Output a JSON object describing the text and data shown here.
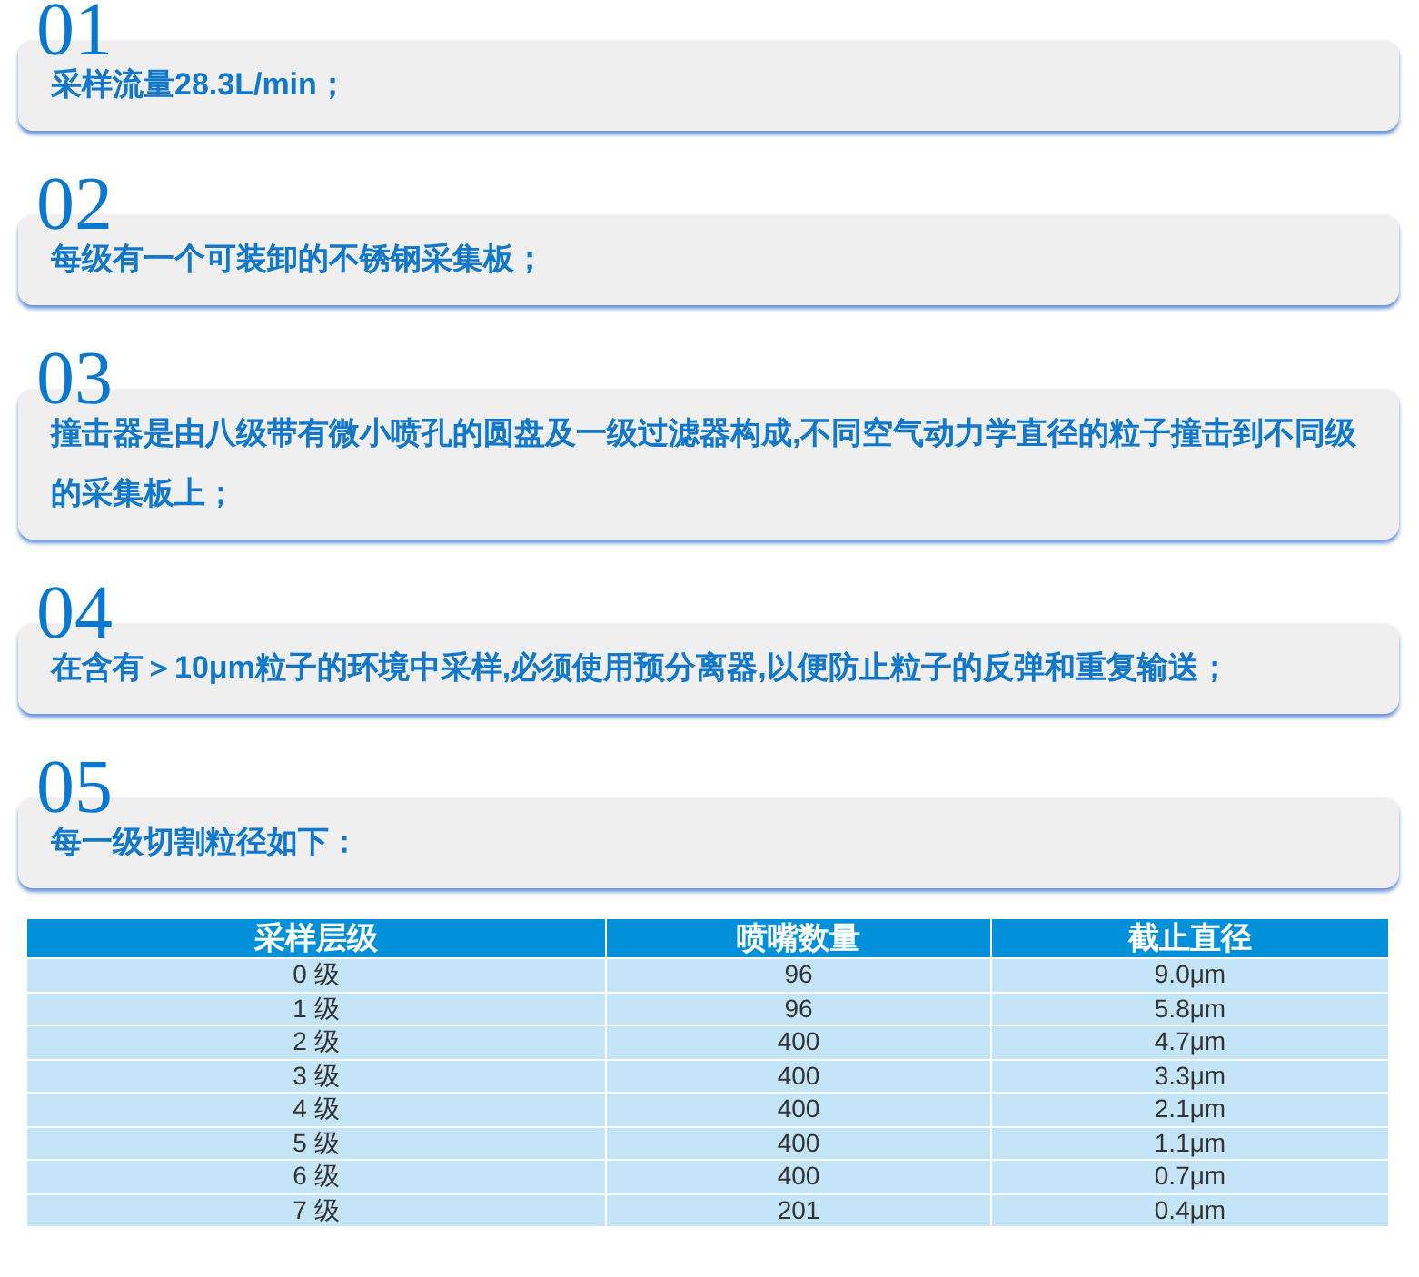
{
  "items": [
    {
      "number": "01",
      "text": "采样流量28.3L/min；"
    },
    {
      "number": "02",
      "text": "每级有一个可装卸的不锈钢采集板；"
    },
    {
      "number": "03",
      "text": "撞击器是由八级带有微小喷孔的圆盘及一级过滤器构成,不同空气动力学直径的粒子撞击到不同级的采集板上；"
    },
    {
      "number": "04",
      "text": "在含有＞10μm粒子的环境中采样,必须使用预分离器,以便防止粒子的反弹和重复输送；"
    },
    {
      "number": "05",
      "text": "每一级切割粒径如下："
    }
  ],
  "table": {
    "columns": [
      "采样层级",
      "喷嘴数量",
      "截止直径"
    ],
    "rows": [
      [
        "0 级",
        "96",
        "9.0μm"
      ],
      [
        "1 级",
        "96",
        "5.8μm"
      ],
      [
        "2 级",
        "400",
        "4.7μm"
      ],
      [
        "3 级",
        "400",
        "3.3μm"
      ],
      [
        "4 级",
        "400",
        "2.1μm"
      ],
      [
        "5 级",
        "400",
        "1.1μm"
      ],
      [
        "6 级",
        "400",
        "0.7μm"
      ],
      [
        "7 级",
        "201",
        "0.4μm"
      ]
    ]
  }
}
